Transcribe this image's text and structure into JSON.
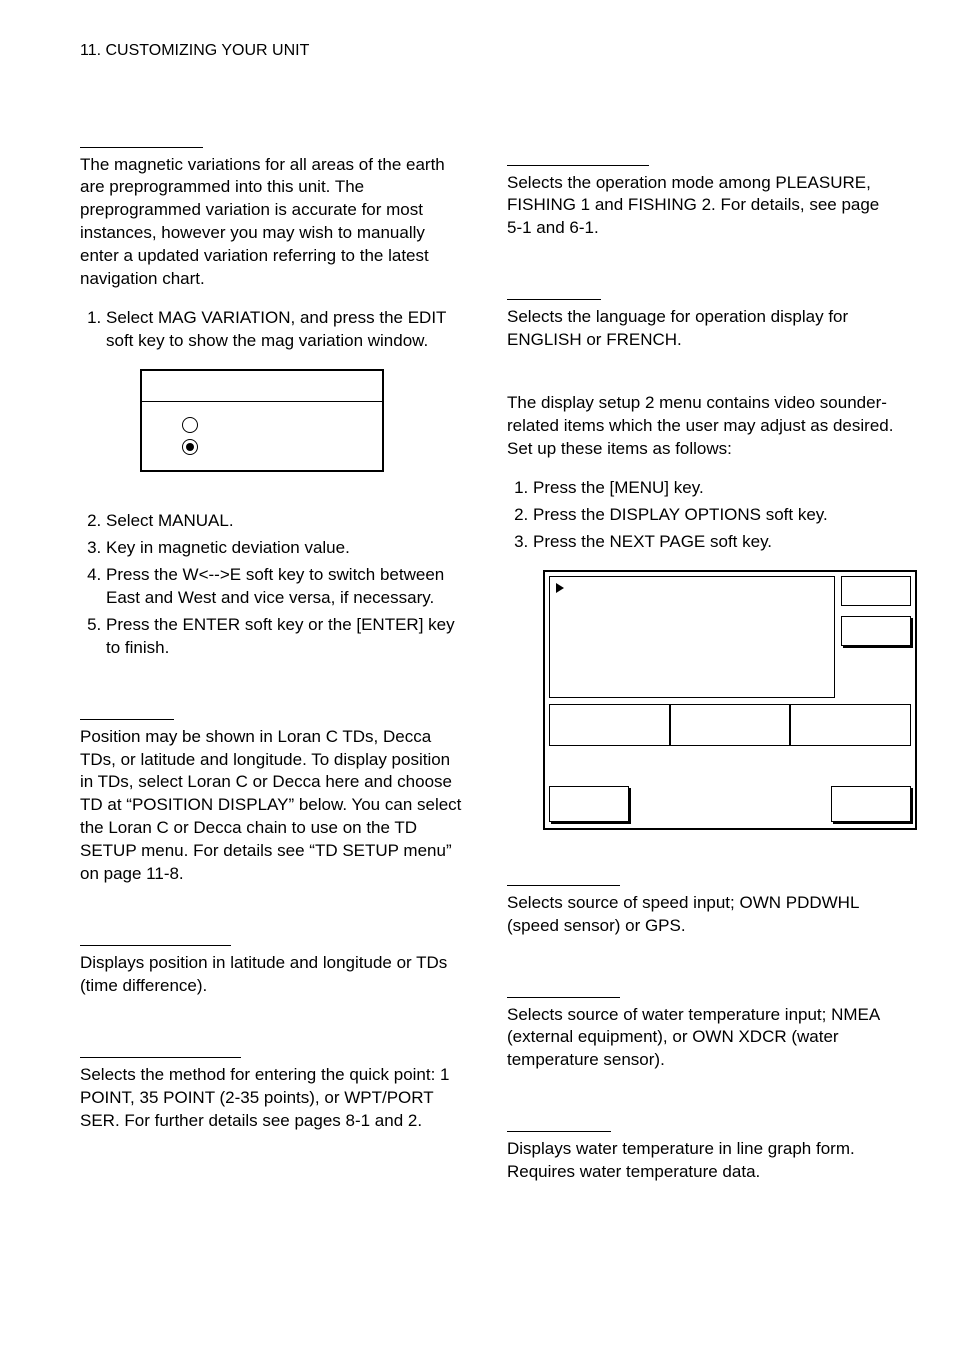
{
  "header": "11. CUSTOMIZING YOUR UNIT",
  "left": {
    "mag_para": "The magnetic variations for all areas of the earth are preprogrammed into this unit. The preprogrammed variation is accurate for most instances, however you may wish to manually enter a updated variation referring to the latest navigation chart.",
    "mag_list": {
      "i1": "Select MAG VARIATION, and press the EDIT soft key to show the mag variation window.",
      "i2": "Select MANUAL.",
      "i3": "Key in magnetic deviation value.",
      "i4": "Press the W<-->E soft key to switch between East and West and vice versa, if necessary.",
      "i5": "Press the ENTER soft key or the [ENTER] key to finish."
    },
    "td_para": "Position may be shown in Loran C TDs, Decca TDs, or latitude and longitude. To display position in TDs, select Loran C or Decca here and choose TD at “POSITION DISPLAY” below. You can select the Loran C or Decca chain to use on the TD SETUP menu. For details see “TD SETUP menu” on page 11-8.",
    "pos_disp_para": "Displays position in latitude and longitude or TDs (time difference).",
    "set_goto_para": "Selects the method for entering the quick point: 1 POINT, 35 POINT (2-35 points), or WPT/PORT SER. For further details see pages 8-1 and 2."
  },
  "right": {
    "op_mode_para": "Selects the operation mode among PLEASURE, FISHING 1 and FISHING 2. For details, see page 5-1 and 6-1.",
    "lang_para": "Selects the language for operation display for ENGLISH or FRENCH.",
    "ds2_intro": "The display setup 2 menu contains video sounder-related items which the user may adjust as desired. Set up these items as follows:",
    "ds2_list": {
      "i1": "Press the [MENU] key.",
      "i2": "Press the DISPLAY OPTIONS soft key.",
      "i3": "Press the NEXT PAGE soft key."
    },
    "spd_para": "Selects source of speed input; OWN PDDWHL (speed sensor) or GPS.",
    "temp_src_para": "Selects source of water temperature input; NMEA (external equipment), or OWN XDCR (water temperature sensor).",
    "temp_graph_para": "Displays water temperature in line graph form. Requires water temperature data."
  }
}
